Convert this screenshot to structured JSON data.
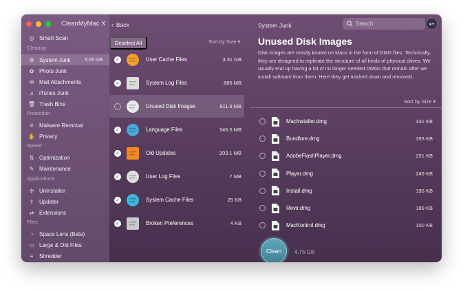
{
  "app": {
    "title": "CleanMyMac X"
  },
  "sidebar": {
    "items": [
      {
        "label": "Smart Scan",
        "icon": "smart-scan-icon",
        "glyph": "◎"
      },
      {
        "label": "System Junk",
        "icon": "system-junk-icon",
        "glyph": "⚙",
        "size": "5.56 GB",
        "active": true
      },
      {
        "label": "Photo Junk",
        "icon": "photo-junk-icon",
        "glyph": "✿"
      },
      {
        "label": "Mail Attachments",
        "icon": "mail-icon",
        "glyph": "✉"
      },
      {
        "label": "iTunes Junk",
        "icon": "music-note-icon",
        "glyph": "♫"
      },
      {
        "label": "Trash Bins",
        "icon": "trash-icon",
        "glyph": "🗑"
      },
      {
        "label": "Malware Removal",
        "icon": "biohazard-icon",
        "glyph": "☣"
      },
      {
        "label": "Privacy",
        "icon": "hand-icon",
        "glyph": "✋"
      },
      {
        "label": "Optimization",
        "icon": "sliders-icon",
        "glyph": "⇅"
      },
      {
        "label": "Maintenance",
        "icon": "wrench-icon",
        "glyph": "✎"
      },
      {
        "label": "Uninstaller",
        "icon": "uninstaller-icon",
        "glyph": "✣"
      },
      {
        "label": "Updater",
        "icon": "updater-icon",
        "glyph": "⇪"
      },
      {
        "label": "Extensions",
        "icon": "extensions-icon",
        "glyph": "⇄"
      },
      {
        "label": "Space Lens (Beta)",
        "icon": "space-lens-icon",
        "glyph": "◔"
      },
      {
        "label": "Large & Old Files",
        "icon": "folder-icon",
        "glyph": "▭"
      },
      {
        "label": "Shredder",
        "icon": "shredder-icon",
        "glyph": "≡"
      }
    ],
    "sections": [
      "Cleanup",
      "Protection",
      "Speed",
      "Applications",
      "Files"
    ]
  },
  "toolbar": {
    "back_label": "Back",
    "panel_title": "System Junk",
    "search_placeholder": "Search"
  },
  "middle": {
    "deselect_label": "Deselect All",
    "sort_label": "Sort by Size",
    "items": [
      {
        "label": "User Cache Files",
        "size": "3.31 GB",
        "checked": true,
        "icon": "user-cache-icon",
        "color": "#f0a030"
      },
      {
        "label": "System Log Files",
        "size": "886 MB",
        "checked": true,
        "icon": "system-log-icon",
        "color": "#dddddd"
      },
      {
        "label": "Unused Disk Images",
        "size": "811.9 MB",
        "checked": false,
        "icon": "disk-image-icon",
        "color": "#e8e8ee",
        "selected": true
      },
      {
        "label": "Language Files",
        "size": "346.6 MB",
        "checked": true,
        "icon": "language-icon",
        "color": "#4aa8d8"
      },
      {
        "label": "Old Updates",
        "size": "203.1 MB",
        "checked": true,
        "icon": "old-updates-icon",
        "color": "#f08a24"
      },
      {
        "label": "User Log Files",
        "size": "7 MB",
        "checked": true,
        "icon": "user-log-icon",
        "color": "#dddddd"
      },
      {
        "label": "System Cache Files",
        "size": "25 KB",
        "checked": true,
        "icon": "system-cache-icon",
        "color": "#3cb8d8"
      },
      {
        "label": "Broken Preferences",
        "size": "4 KB",
        "checked": true,
        "icon": "broken-prefs-icon",
        "color": "#c8c8d0"
      }
    ]
  },
  "detail": {
    "title": "Unused Disk Images",
    "description": "Disk images are mostly known on Macs in the form of DMG files. Technically, they are designed to replicate the structure of all kinds of physical drives. We usually end up having a lot of no longer needed DMGs that remain after we install software from them. Here they get tracked down and removed.",
    "sort_label": "Sort by Size",
    "files": [
      {
        "name": "MacInstaller.dmg",
        "size": "431 KB"
      },
      {
        "name": "Bundlore.dmg",
        "size": "393 KB"
      },
      {
        "name": "AdobeFlashPlayer.dmg",
        "size": "251 KB"
      },
      {
        "name": "Player.dmg",
        "size": "249 KB"
      },
      {
        "name": "Install.dmg",
        "size": "196 KB"
      },
      {
        "name": "Revir.dmg",
        "size": "189 KB"
      },
      {
        "name": "MacKontrol.dmg",
        "size": "100 KB"
      }
    ]
  },
  "footer": {
    "clean_label": "Clean",
    "total_size": "4.75 GB"
  }
}
